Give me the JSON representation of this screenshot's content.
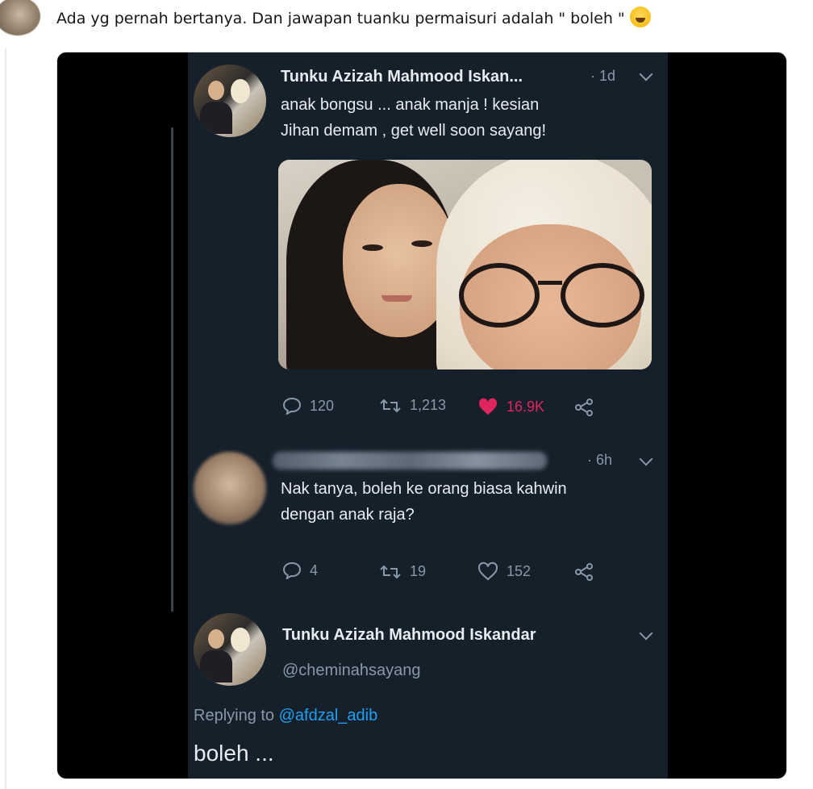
{
  "post": {
    "text": "Ada yg pernah bertanya. Dan jawapan tuanku permaisuri adalah \" boleh \"",
    "emoji": "face-with-tears-of-joy-icon"
  },
  "tweet1": {
    "author": "Tunku Azizah Mahmood Iskan...",
    "time": "· 1d",
    "line1": "anak bongsu ... anak manja ! kesian",
    "line2": "Jihan demam , get well soon sayang!",
    "replies": "120",
    "retweets": "1,213",
    "likes": "16.9K"
  },
  "tweet2": {
    "time": "· 6h",
    "line1": "Nak tanya, boleh ke orang biasa kahwin",
    "line2": "dengan anak raja?",
    "replies": "4",
    "retweets": "19",
    "likes": "152"
  },
  "tweet3": {
    "author": "Tunku Azizah Mahmood Iskandar",
    "handle": "@cheminahsayang",
    "replying_prefix": "Replying to",
    "replying_to": "@afdzal_adib",
    "text": "boleh ..."
  },
  "colors": {
    "tweet_bg": "#15202b",
    "text": "#e6ecf0",
    "muted": "#8899a6",
    "like": "#e0245e",
    "link": "#1da1f2"
  }
}
